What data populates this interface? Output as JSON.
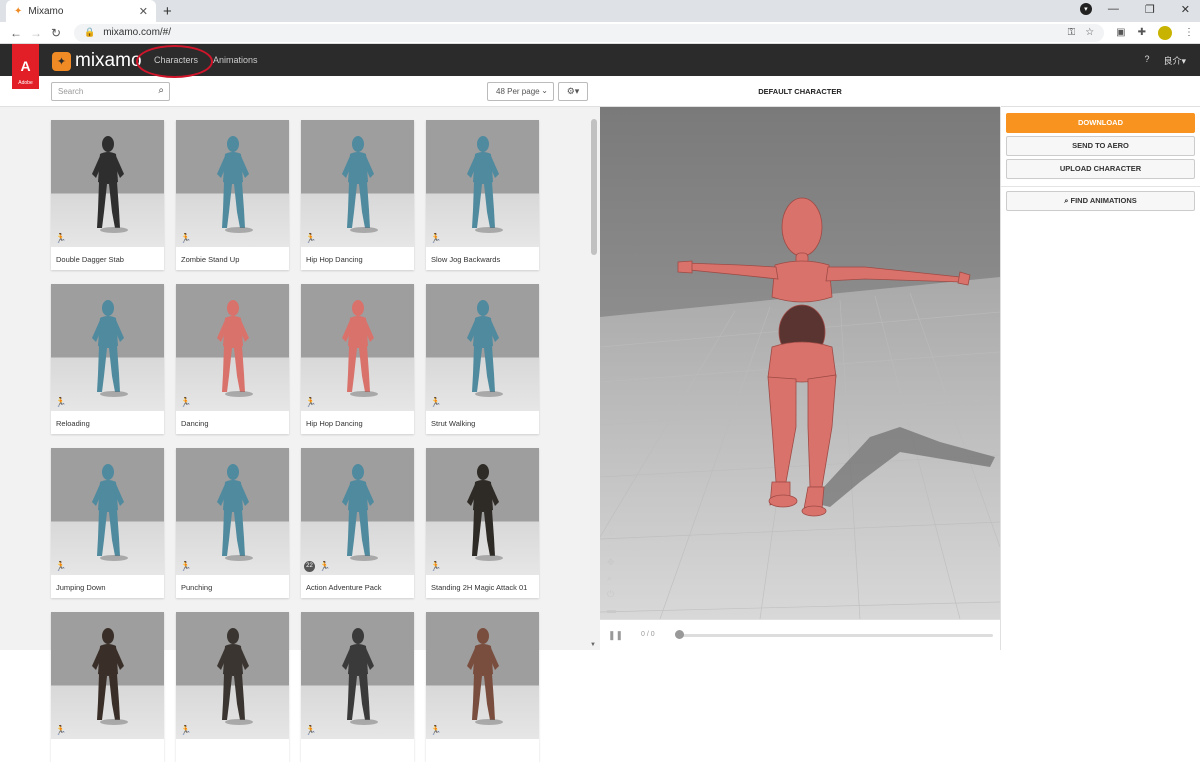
{
  "browser": {
    "tab_title": "Mixamo",
    "url": "mixamo.com/#/"
  },
  "header": {
    "brand": "mixamo",
    "adobe": "Adobe",
    "nav": {
      "characters": "Characters",
      "animations": "Animations"
    },
    "help_icon": "help-icon",
    "user": "良介"
  },
  "toolbar": {
    "search_placeholder": "Search",
    "per_page": "48 Per page"
  },
  "cards": [
    {
      "label": "Double Dagger Stab",
      "color": "#2e2e2e"
    },
    {
      "label": "Zombie Stand Up",
      "color": "#4f8a9e"
    },
    {
      "label": "Hip Hop Dancing",
      "color": "#4f8a9e"
    },
    {
      "label": "Slow Jog Backwards",
      "color": "#4f8a9e"
    },
    {
      "label": "Reloading",
      "color": "#4f8a9e"
    },
    {
      "label": "Dancing",
      "color": "#d9726b"
    },
    {
      "label": "Hip Hop Dancing",
      "color": "#d9726b"
    },
    {
      "label": "Strut Walking",
      "color": "#4f8a9e"
    },
    {
      "label": "Jumping Down",
      "color": "#4f8a9e"
    },
    {
      "label": "Punching",
      "color": "#4f8a9e"
    },
    {
      "label": "Action Adventure Pack",
      "color": "#4f8a9e",
      "pack_count": "22"
    },
    {
      "label": "Standing 2H Magic Attack 01",
      "color": "#2e2a25"
    },
    {
      "label": "",
      "color": "#3a2f28"
    },
    {
      "label": "",
      "color": "#3a3530"
    },
    {
      "label": "",
      "color": "#3a3a3a"
    },
    {
      "label": "",
      "color": "#7a4e3e"
    }
  ],
  "viewer": {
    "title": "DEFAULT CHARACTER",
    "frame": "0 / 0"
  },
  "actions": {
    "download": "DOWNLOAD",
    "send_to_aero": "SEND TO AERO",
    "upload_character": "UPLOAD CHARACTER",
    "find_animations": "FIND ANIMATIONS"
  },
  "colors": {
    "accent": "#f7931e",
    "adobe_red": "#e21e26",
    "header_bg": "#2b2b2b",
    "character": "#d9726b"
  }
}
